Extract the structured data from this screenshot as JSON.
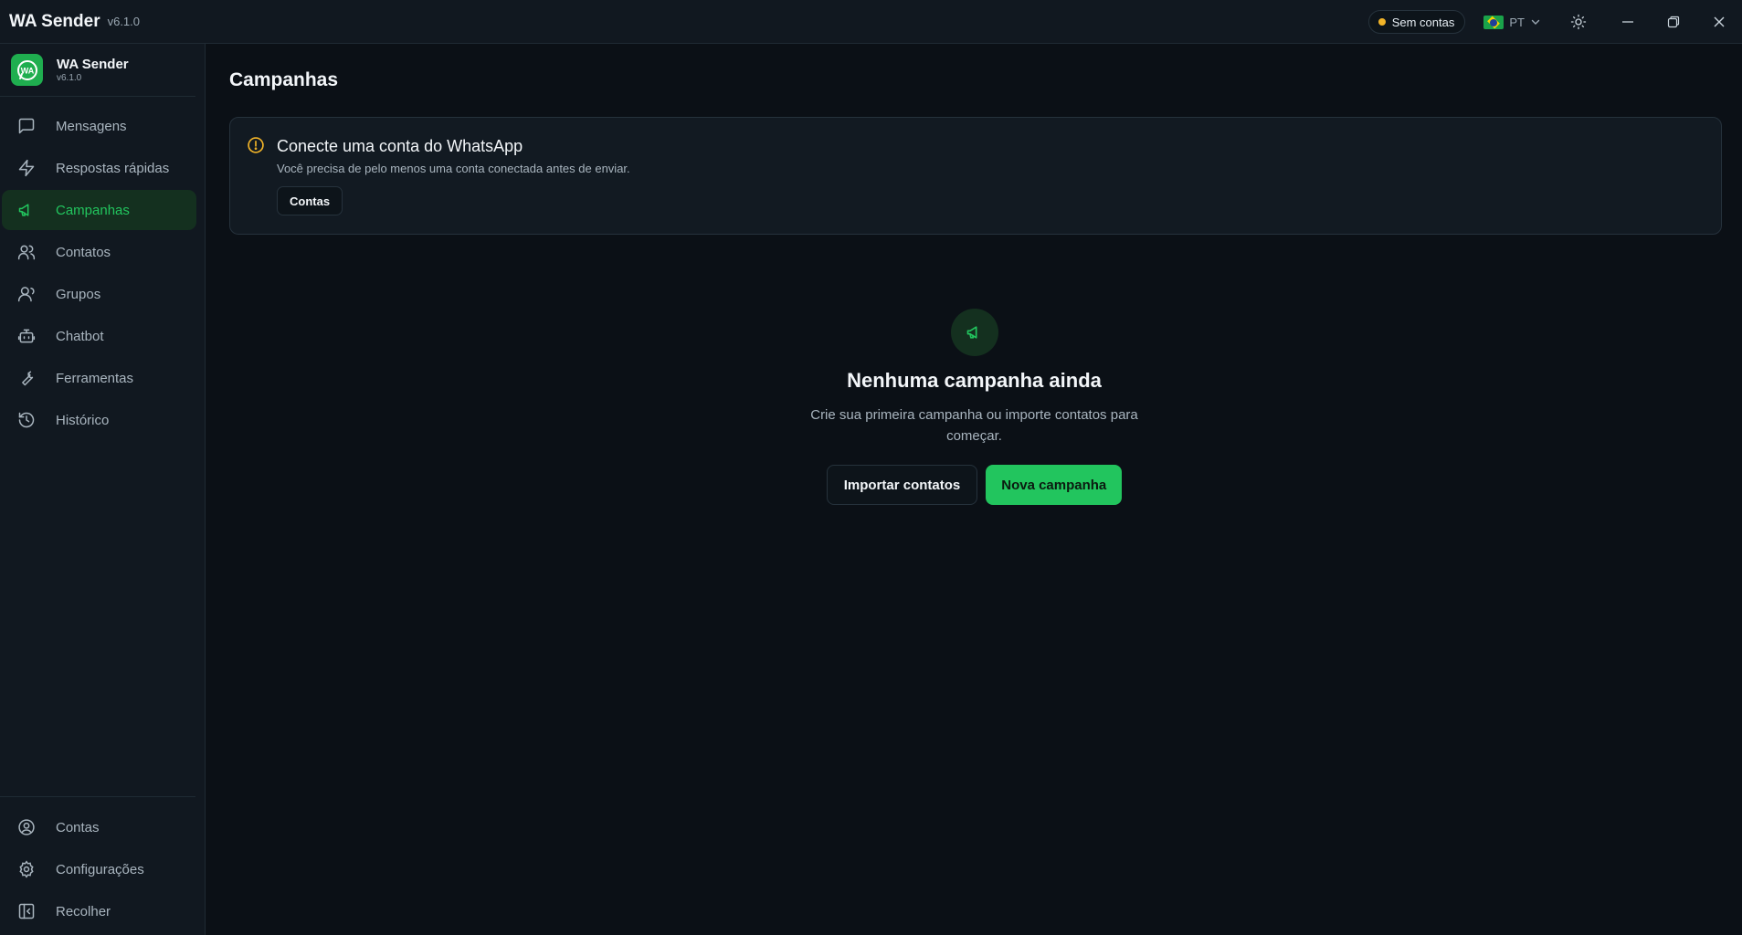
{
  "titlebar": {
    "app_name": "WA Sender",
    "version": "v6.1.0",
    "status_label": "Sem contas",
    "language_code": "PT",
    "status_color": "#f2b428"
  },
  "sidebar": {
    "brand_name": "WA Sender",
    "brand_version": "v6.1.0",
    "brand_logo_text": "WA",
    "items": [
      {
        "label": "Mensagens",
        "icon": "message-square-icon"
      },
      {
        "label": "Respostas rápidas",
        "icon": "zap-icon"
      },
      {
        "label": "Campanhas",
        "icon": "megaphone-icon",
        "active": true
      },
      {
        "label": "Contatos",
        "icon": "users-icon"
      },
      {
        "label": "Grupos",
        "icon": "group-icon"
      },
      {
        "label": "Chatbot",
        "icon": "bot-icon"
      },
      {
        "label": "Ferramentas",
        "icon": "wrench-icon"
      },
      {
        "label": "Histórico",
        "icon": "history-icon"
      }
    ],
    "bottom_items": [
      {
        "label": "Contas",
        "icon": "user-circle-icon"
      },
      {
        "label": "Configurações",
        "icon": "gear-icon"
      },
      {
        "label": "Recolher",
        "icon": "collapse-sidebar-icon"
      }
    ]
  },
  "main": {
    "title": "Campanhas",
    "alert": {
      "title": "Conecte uma conta do WhatsApp",
      "description": "Você precisa de pelo menos uma conta conectada antes de enviar.",
      "button_label": "Contas"
    },
    "empty_state": {
      "title": "Nenhuma campanha ainda",
      "description": "Crie sua primeira campanha ou importe contatos para começar.",
      "secondary_label": "Importar contatos",
      "primary_label": "Nova campanha"
    }
  },
  "colors": {
    "accent": "#22c55e",
    "background": "#0b1016",
    "warning": "#f2b428"
  }
}
